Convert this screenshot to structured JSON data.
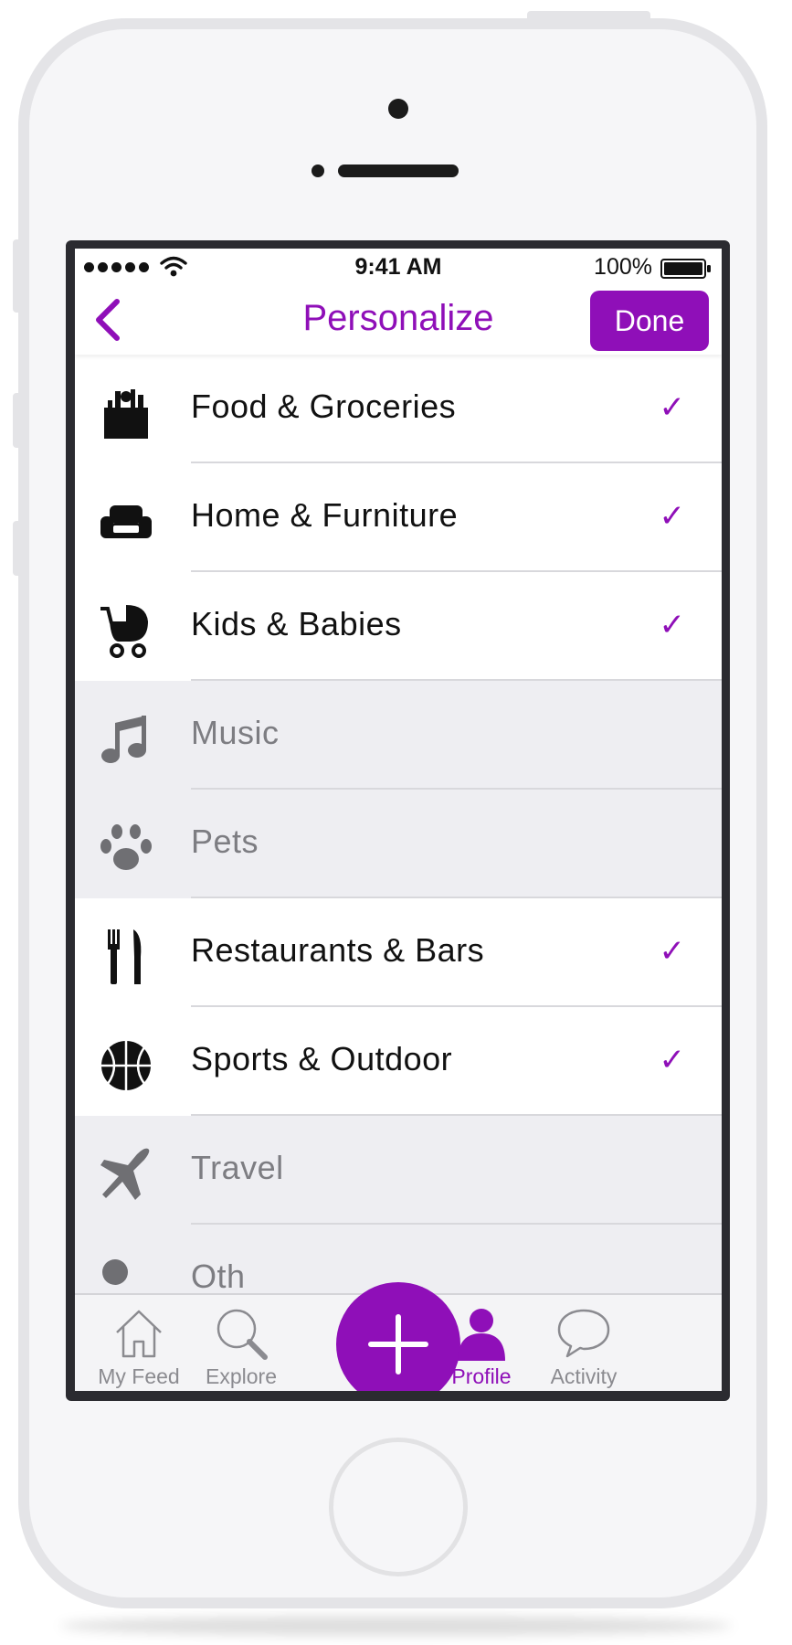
{
  "status_bar": {
    "time": "9:41 AM",
    "battery": "100%"
  },
  "header": {
    "title": "Personalize",
    "done_label": "Done"
  },
  "categories": [
    {
      "label": "Food & Groceries",
      "icon": "shopping-bag-icon",
      "selected": true
    },
    {
      "label": "Home & Furniture",
      "icon": "sofa-icon",
      "selected": true
    },
    {
      "label": "Kids & Babies",
      "icon": "stroller-icon",
      "selected": true
    },
    {
      "label": "Music",
      "icon": "music-note-icon",
      "selected": false
    },
    {
      "label": "Pets",
      "icon": "paw-icon",
      "selected": false
    },
    {
      "label": "Restaurants & Bars",
      "icon": "fork-knife-icon",
      "selected": true
    },
    {
      "label": "Sports & Outdoor",
      "icon": "basketball-icon",
      "selected": true
    },
    {
      "label": "Travel",
      "icon": "airplane-icon",
      "selected": false
    },
    {
      "label": "Oth",
      "icon": "other-icon",
      "selected": false
    }
  ],
  "checkmark": "✓",
  "tabs": [
    {
      "label": "My Feed",
      "icon": "home-icon",
      "active": false
    },
    {
      "label": "Explore",
      "icon": "search-icon",
      "active": false
    },
    {
      "label": "Profile",
      "icon": "person-icon",
      "active": true
    },
    {
      "label": "Activity",
      "icon": "speech-bubble-icon",
      "active": false
    }
  ],
  "colors": {
    "accent": "#8f0fb8",
    "unselected_row": "#eeeef2",
    "text": "#111111",
    "muted_text": "#7d7d82"
  }
}
